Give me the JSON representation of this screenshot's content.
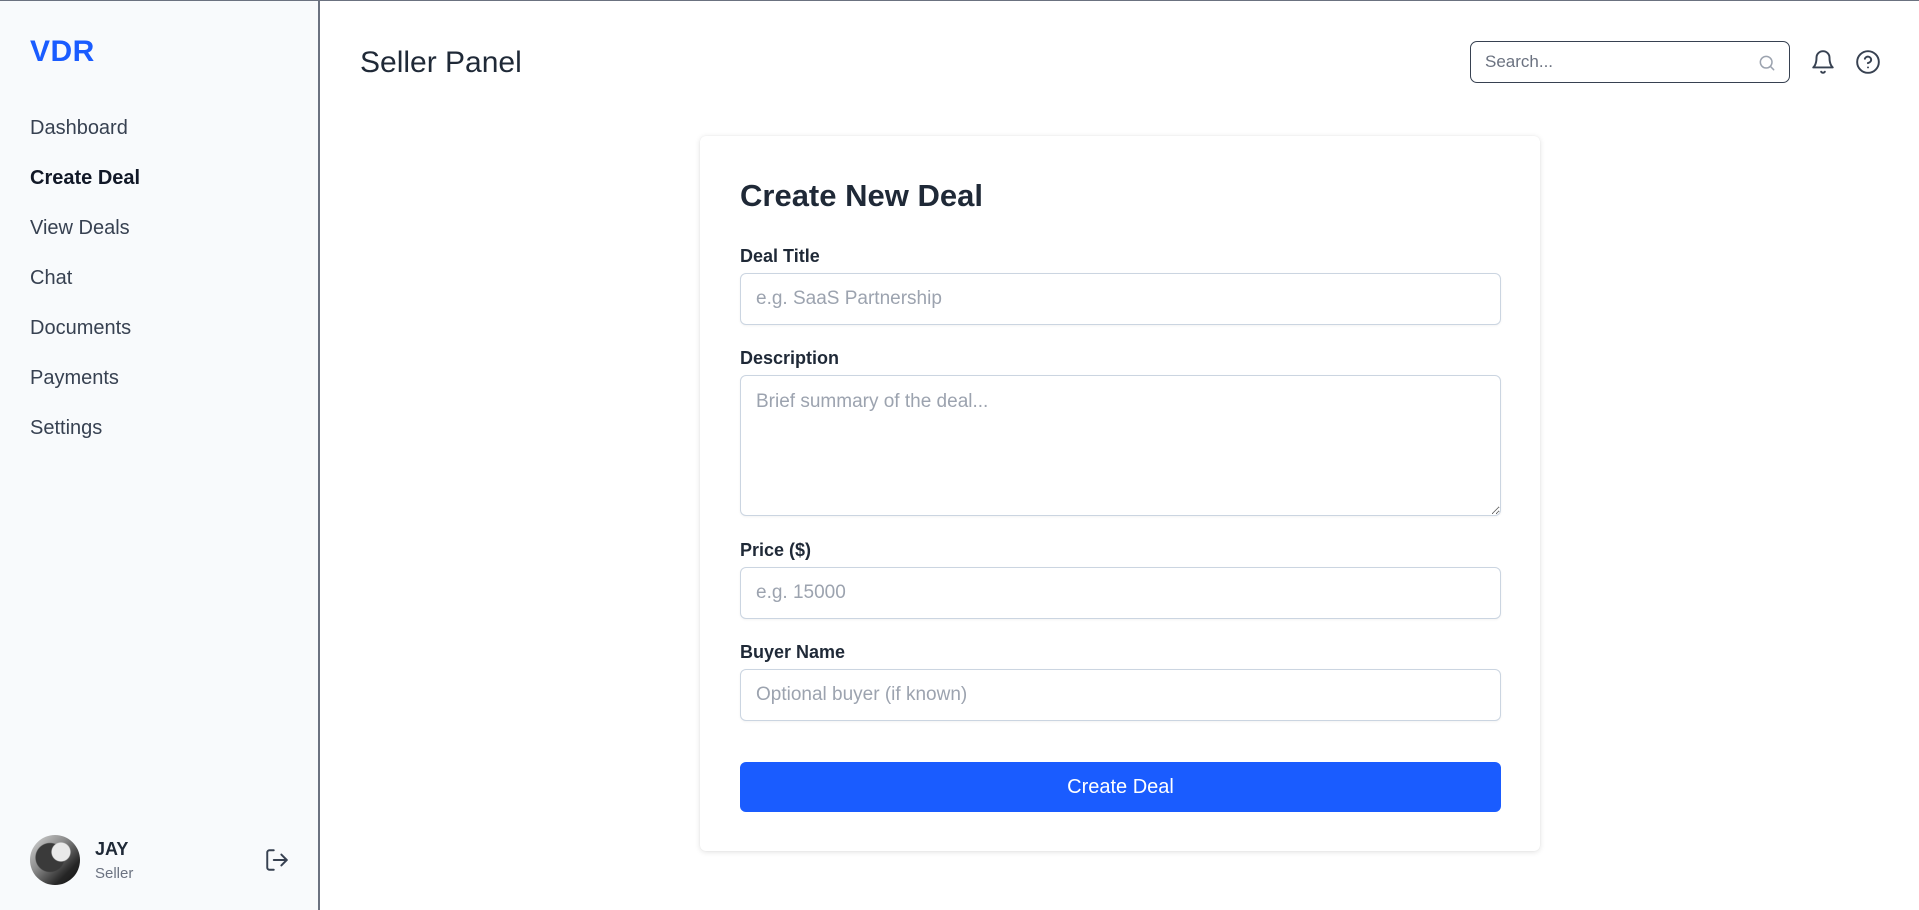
{
  "sidebar": {
    "brand": "VDR",
    "items": [
      {
        "label": "Dashboard"
      },
      {
        "label": "Create Deal",
        "active": true
      },
      {
        "label": "View Deals"
      },
      {
        "label": "Chat"
      },
      {
        "label": "Documents"
      },
      {
        "label": "Payments"
      },
      {
        "label": "Settings"
      }
    ],
    "user": {
      "name": "JAY",
      "role": "Seller",
      "logout_icon": "logout-icon"
    }
  },
  "header": {
    "title": "Seller Panel",
    "search_placeholder": "Search...",
    "icons": [
      "search-icon",
      "bell-icon",
      "help-icon"
    ]
  },
  "form": {
    "title": "Create New Deal",
    "deal_title": {
      "label": "Deal Title",
      "placeholder": "e.g. SaaS Partnership",
      "value": ""
    },
    "description": {
      "label": "Description",
      "placeholder": "Brief summary of the deal...",
      "value": ""
    },
    "price": {
      "label": "Price ($)",
      "placeholder": "e.g. 15000",
      "value": ""
    },
    "buyer_name": {
      "label": "Buyer Name",
      "placeholder": "Optional buyer (if known)",
      "value": ""
    },
    "submit_label": "Create Deal"
  },
  "colors": {
    "accent": "#1a5cff",
    "sidebar_bg": "#f8fafc",
    "text_dark": "#1f2937"
  }
}
